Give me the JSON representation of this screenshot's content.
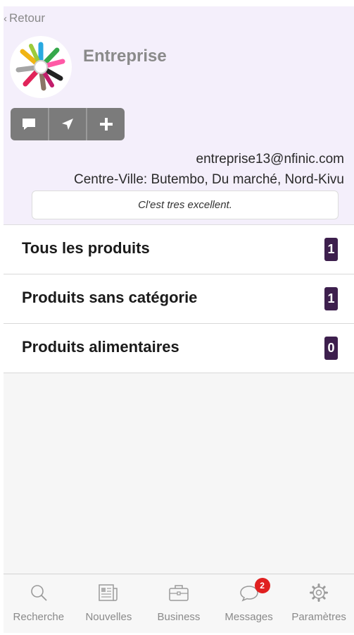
{
  "header": {
    "back_label": "Retour",
    "company_name": "Entreprise",
    "email": "entreprise13@nfinic.com",
    "address": "Centre-Ville: Butembo, Du marché, Nord-Kivu",
    "tagline": "Cl'est tres excellent."
  },
  "actions": [
    {
      "icon": "comment-icon"
    },
    {
      "icon": "location-arrow-icon"
    },
    {
      "icon": "plus-icon"
    }
  ],
  "categories": [
    {
      "label": "Tous les produits",
      "count": "1"
    },
    {
      "label": "Produits sans catégorie",
      "count": "1"
    },
    {
      "label": "Produits alimentaires",
      "count": "0"
    }
  ],
  "tabbar": {
    "tabs": [
      {
        "label": "Recherche",
        "icon": "search-icon"
      },
      {
        "label": "Nouvelles",
        "icon": "newspaper-icon"
      },
      {
        "label": "Business",
        "icon": "briefcase-icon"
      },
      {
        "label": "Messages",
        "icon": "chat-icon",
        "badge": "2"
      },
      {
        "label": "Paramètres",
        "icon": "gear-icon"
      }
    ]
  },
  "colors": {
    "profile_bg": "#f4effb",
    "badge_bg": "#3d1f4d",
    "notification": "#e02020",
    "button_group": "#7b7b7b"
  }
}
